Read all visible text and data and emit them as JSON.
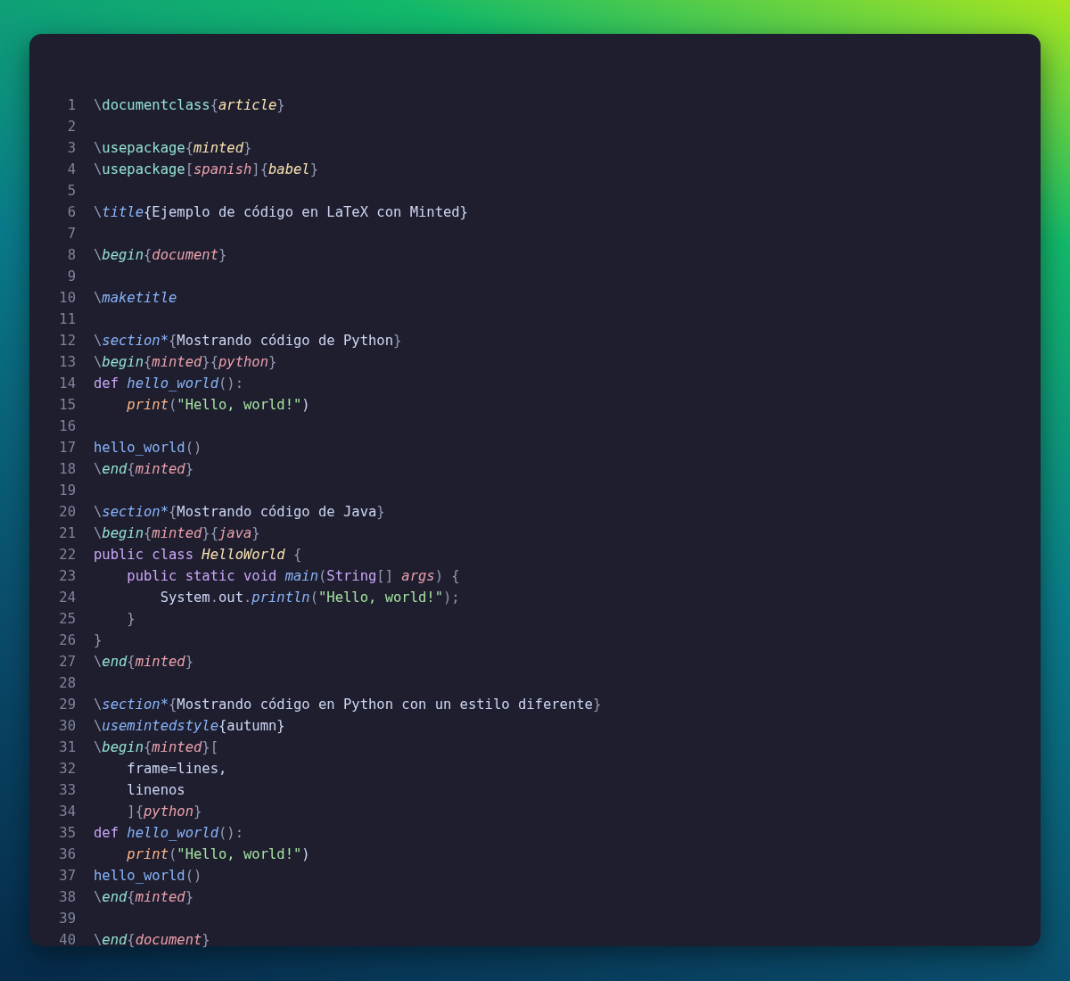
{
  "editor": {
    "lines": [
      {
        "number": "1",
        "tokens": [
          {
            "text": "\\",
            "kind": "bs"
          },
          {
            "text": "documentclass",
            "kind": "cmd"
          },
          {
            "text": "{",
            "kind": "p"
          },
          {
            "text": "article",
            "kind": "ay"
          },
          {
            "text": "}",
            "kind": "p"
          }
        ]
      },
      {
        "number": "2"
      },
      {
        "number": "3",
        "tokens": [
          {
            "text": "\\",
            "kind": "bs"
          },
          {
            "text": "usepackage",
            "kind": "cmd"
          },
          {
            "text": "{",
            "kind": "p"
          },
          {
            "text": "minted",
            "kind": "ay"
          },
          {
            "text": "}",
            "kind": "p"
          }
        ]
      },
      {
        "number": "4",
        "tokens": [
          {
            "text": "\\",
            "kind": "bs"
          },
          {
            "text": "usepackage",
            "kind": "cmd"
          },
          {
            "text": "[",
            "kind": "p"
          },
          {
            "text": "spanish",
            "kind": "ar"
          },
          {
            "text": "]{",
            "kind": "p"
          },
          {
            "text": "babel",
            "kind": "ay"
          },
          {
            "text": "}",
            "kind": "p"
          }
        ]
      },
      {
        "number": "5"
      },
      {
        "number": "6",
        "tokens": [
          {
            "text": "\\",
            "kind": "bs"
          },
          {
            "text": "title",
            "kind": "fn"
          },
          {
            "text": "{Ejemplo de código en LaTeX con Minted}",
            "kind": "t"
          }
        ]
      },
      {
        "number": "7"
      },
      {
        "number": "8",
        "tokens": [
          {
            "text": "\\",
            "kind": "bs"
          },
          {
            "text": "begin",
            "kind": "cmdi"
          },
          {
            "text": "{",
            "kind": "p"
          },
          {
            "text": "document",
            "kind": "ar"
          },
          {
            "text": "}",
            "kind": "p"
          }
        ]
      },
      {
        "number": "9"
      },
      {
        "number": "10",
        "tokens": [
          {
            "text": "\\",
            "kind": "bs"
          },
          {
            "text": "maketitle",
            "kind": "fn"
          }
        ]
      },
      {
        "number": "11"
      },
      {
        "number": "12",
        "tokens": [
          {
            "text": "\\",
            "kind": "bs"
          },
          {
            "text": "section*",
            "kind": "fn"
          },
          {
            "text": "{",
            "kind": "p"
          },
          {
            "text": "Mostrando código de Python",
            "kind": "t"
          },
          {
            "text": "}",
            "kind": "p"
          }
        ]
      },
      {
        "number": "13",
        "tokens": [
          {
            "text": "\\",
            "kind": "bs"
          },
          {
            "text": "begin",
            "kind": "cmdi"
          },
          {
            "text": "{",
            "kind": "p"
          },
          {
            "text": "minted",
            "kind": "ar"
          },
          {
            "text": "}{",
            "kind": "p"
          },
          {
            "text": "python",
            "kind": "ar"
          },
          {
            "text": "}",
            "kind": "p"
          }
        ]
      },
      {
        "number": "14",
        "tokens": [
          {
            "text": "def",
            "kind": "kw"
          },
          {
            "text": " hello_world",
            "kind": "fn"
          },
          {
            "text": "():",
            "kind": "p"
          }
        ]
      },
      {
        "number": "15",
        "tokens": [
          {
            "text": "    print",
            "kind": "bi"
          },
          {
            "text": "(",
            "kind": "p"
          },
          {
            "text": "\"Hello, world!\"",
            "kind": "str"
          },
          {
            "text": ")",
            "kind": "t"
          }
        ]
      },
      {
        "number": "16"
      },
      {
        "number": "17",
        "tokens": [
          {
            "text": "hello_world",
            "kind": "call"
          },
          {
            "text": "()",
            "kind": "p"
          }
        ]
      },
      {
        "number": "18",
        "tokens": [
          {
            "text": "\\",
            "kind": "bs"
          },
          {
            "text": "end",
            "kind": "cmdi"
          },
          {
            "text": "{",
            "kind": "p"
          },
          {
            "text": "minted",
            "kind": "ar"
          },
          {
            "text": "}",
            "kind": "p"
          }
        ]
      },
      {
        "number": "19"
      },
      {
        "number": "20",
        "tokens": [
          {
            "text": "\\",
            "kind": "bs"
          },
          {
            "text": "section*",
            "kind": "fn"
          },
          {
            "text": "{",
            "kind": "p"
          },
          {
            "text": "Mostrando código de Java",
            "kind": "t"
          },
          {
            "text": "}",
            "kind": "p"
          }
        ]
      },
      {
        "number": "21",
        "tokens": [
          {
            "text": "\\",
            "kind": "bs"
          },
          {
            "text": "begin",
            "kind": "cmdi"
          },
          {
            "text": "{",
            "kind": "p"
          },
          {
            "text": "minted",
            "kind": "ar"
          },
          {
            "text": "}{",
            "kind": "p"
          },
          {
            "text": "java",
            "kind": "ar"
          },
          {
            "text": "}",
            "kind": "p"
          }
        ]
      },
      {
        "number": "22",
        "tokens": [
          {
            "text": "public class",
            "kind": "kw"
          },
          {
            "text": " HelloWorld",
            "kind": "ty"
          },
          {
            "text": " {",
            "kind": "p"
          }
        ]
      },
      {
        "number": "23",
        "tokens": [
          {
            "text": "    public static void",
            "kind": "kw"
          },
          {
            "text": " main",
            "kind": "fn"
          },
          {
            "text": "(",
            "kind": "p"
          },
          {
            "text": "String",
            "kind": "kw"
          },
          {
            "text": "[] ",
            "kind": "p"
          },
          {
            "text": "args",
            "kind": "ar"
          },
          {
            "text": ") {",
            "kind": "p"
          }
        ]
      },
      {
        "number": "24",
        "tokens": [
          {
            "text": "        System",
            "kind": "t"
          },
          {
            "text": ".",
            "kind": "p"
          },
          {
            "text": "out",
            "kind": "t"
          },
          {
            "text": ".",
            "kind": "p"
          },
          {
            "text": "println",
            "kind": "fn"
          },
          {
            "text": "(",
            "kind": "p"
          },
          {
            "text": "\"Hello, world!\"",
            "kind": "str"
          },
          {
            "text": ");",
            "kind": "p"
          }
        ]
      },
      {
        "number": "25",
        "tokens": [
          {
            "text": "    }",
            "kind": "p"
          }
        ]
      },
      {
        "number": "26",
        "tokens": [
          {
            "text": "}",
            "kind": "p"
          }
        ]
      },
      {
        "number": "27",
        "tokens": [
          {
            "text": "\\",
            "kind": "bs"
          },
          {
            "text": "end",
            "kind": "cmdi"
          },
          {
            "text": "{",
            "kind": "p"
          },
          {
            "text": "minted",
            "kind": "ar"
          },
          {
            "text": "}",
            "kind": "p"
          }
        ]
      },
      {
        "number": "28"
      },
      {
        "number": "29",
        "tokens": [
          {
            "text": "\\",
            "kind": "bs"
          },
          {
            "text": "section*",
            "kind": "fn"
          },
          {
            "text": "{",
            "kind": "p"
          },
          {
            "text": "Mostrando código en Python con un estilo diferente",
            "kind": "t"
          },
          {
            "text": "}",
            "kind": "p"
          }
        ]
      },
      {
        "number": "30",
        "tokens": [
          {
            "text": "\\",
            "kind": "bs"
          },
          {
            "text": "usemintedstyle",
            "kind": "fn"
          },
          {
            "text": "{autumn}",
            "kind": "t"
          }
        ]
      },
      {
        "number": "31",
        "tokens": [
          {
            "text": "\\",
            "kind": "bs"
          },
          {
            "text": "begin",
            "kind": "cmdi"
          },
          {
            "text": "{",
            "kind": "p"
          },
          {
            "text": "minted",
            "kind": "ar"
          },
          {
            "text": "}[",
            "kind": "p"
          }
        ]
      },
      {
        "number": "32",
        "tokens": [
          {
            "text": "    frame=lines,",
            "kind": "t"
          }
        ]
      },
      {
        "number": "33",
        "tokens": [
          {
            "text": "    linenos",
            "kind": "t"
          }
        ]
      },
      {
        "number": "34",
        "tokens": [
          {
            "text": "    ]{",
            "kind": "p"
          },
          {
            "text": "python",
            "kind": "ar"
          },
          {
            "text": "}",
            "kind": "p"
          }
        ]
      },
      {
        "number": "35",
        "tokens": [
          {
            "text": "def",
            "kind": "kw"
          },
          {
            "text": " hello_world",
            "kind": "fn"
          },
          {
            "text": "():",
            "kind": "p"
          }
        ]
      },
      {
        "number": "36",
        "tokens": [
          {
            "text": "    print",
            "kind": "bi"
          },
          {
            "text": "(",
            "kind": "p"
          },
          {
            "text": "\"Hello, world!\"",
            "kind": "str"
          },
          {
            "text": ")",
            "kind": "t"
          }
        ]
      },
      {
        "number": "37",
        "tokens": [
          {
            "text": "hello_world",
            "kind": "call"
          },
          {
            "text": "()",
            "kind": "p"
          }
        ]
      },
      {
        "number": "38",
        "tokens": [
          {
            "text": "\\",
            "kind": "bs"
          },
          {
            "text": "end",
            "kind": "cmdi"
          },
          {
            "text": "{",
            "kind": "p"
          },
          {
            "text": "minted",
            "kind": "ar"
          },
          {
            "text": "}",
            "kind": "p"
          }
        ]
      },
      {
        "number": "39"
      },
      {
        "number": "40",
        "tokens": [
          {
            "text": "\\",
            "kind": "bs"
          },
          {
            "text": "end",
            "kind": "cmdi"
          },
          {
            "text": "{",
            "kind": "p"
          },
          {
            "text": "document",
            "kind": "ar"
          },
          {
            "text": "}",
            "kind": "p"
          }
        ]
      }
    ]
  }
}
